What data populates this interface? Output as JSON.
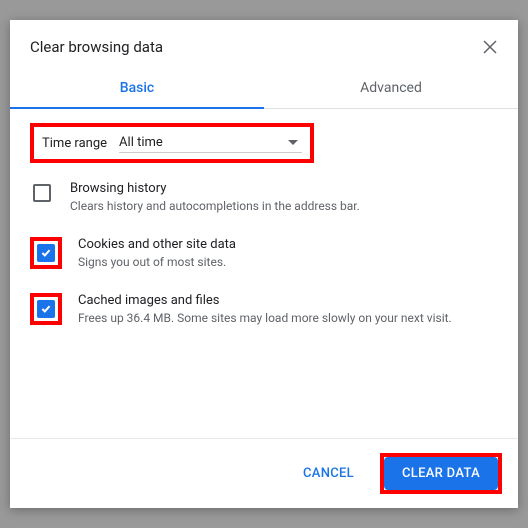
{
  "dialog": {
    "title": "Clear browsing data",
    "tabs": {
      "basic": "Basic",
      "advanced": "Advanced",
      "active": "basic"
    },
    "time_range": {
      "label": "Time range",
      "value": "All time"
    },
    "options": [
      {
        "title": "Browsing history",
        "desc": "Clears history and autocompletions in the address bar.",
        "checked": false,
        "highlight": false
      },
      {
        "title": "Cookies and other site data",
        "desc": "Signs you out of most sites.",
        "checked": true,
        "highlight": true
      },
      {
        "title": "Cached images and files",
        "desc": "Frees up 36.4 MB. Some sites may load more slowly on your next visit.",
        "checked": true,
        "highlight": true
      }
    ],
    "buttons": {
      "cancel": "CANCEL",
      "confirm": "CLEAR DATA"
    }
  }
}
